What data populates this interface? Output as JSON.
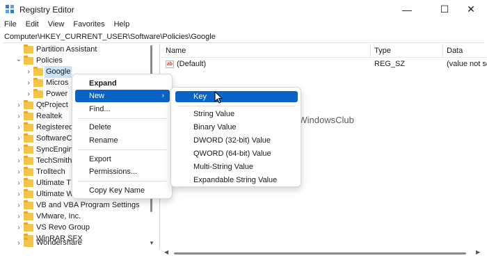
{
  "window": {
    "title": "Registry Editor",
    "controls": {
      "minimize": "—",
      "maximize": "☐",
      "close": "✕"
    }
  },
  "menubar": {
    "items": [
      "File",
      "Edit",
      "View",
      "Favorites",
      "Help"
    ]
  },
  "address": {
    "path": "Computer\\HKEY_CURRENT_USER\\Software\\Policies\\Google"
  },
  "tree": {
    "items": [
      {
        "label": "Partition Assistant",
        "expand": "",
        "depth": 1
      },
      {
        "label": "Policies",
        "expand": "⌄",
        "depth": 1
      },
      {
        "label": "Google",
        "expand": "›",
        "depth": 2,
        "selected": true
      },
      {
        "label": "Micros",
        "expand": "›",
        "depth": 2
      },
      {
        "label": "Power",
        "expand": "›",
        "depth": 2
      },
      {
        "label": "QtProject",
        "expand": "›",
        "depth": 1
      },
      {
        "label": "Realtek",
        "expand": "›",
        "depth": 1
      },
      {
        "label": "Registered",
        "expand": "›",
        "depth": 1
      },
      {
        "label": "SoftwareC",
        "expand": "›",
        "depth": 1
      },
      {
        "label": "SyncEngin",
        "expand": "›",
        "depth": 1
      },
      {
        "label": "TechSmith",
        "expand": "›",
        "depth": 1
      },
      {
        "label": "Trolltech",
        "expand": "›",
        "depth": 1
      },
      {
        "label": "Ultimate T",
        "expand": "›",
        "depth": 1
      },
      {
        "label": "Ultimate W",
        "expand": "›",
        "depth": 1
      },
      {
        "label": "VB and VBA Program Settings",
        "expand": "›",
        "depth": 1
      },
      {
        "label": "VMware, Inc.",
        "expand": "›",
        "depth": 1
      },
      {
        "label": "VS Revo Group",
        "expand": "›",
        "depth": 1
      },
      {
        "label": "WinRAR SFX",
        "expand": "",
        "depth": 1
      },
      {
        "label": "Wondershare",
        "expand": "›",
        "depth": 1
      }
    ]
  },
  "list": {
    "columns": {
      "name": "Name",
      "type": "Type",
      "data": "Data"
    },
    "rows": [
      {
        "icon": "ab",
        "name": "(Default)",
        "type": "REG_SZ",
        "data": "(value not se"
      }
    ]
  },
  "context_menu": {
    "items": [
      {
        "label": "Expand",
        "bold": true
      },
      {
        "label": "New",
        "highlighted": true,
        "submenu_arrow": "›"
      },
      {
        "label": "Find..."
      },
      {
        "label": "Delete"
      },
      {
        "label": "Rename"
      },
      {
        "label": "Export"
      },
      {
        "label": "Permissions..."
      },
      {
        "label": "Copy Key Name"
      }
    ]
  },
  "sub_menu": {
    "items": [
      {
        "label": "Key",
        "highlighted": true
      },
      {
        "label": "String Value"
      },
      {
        "label": "Binary Value"
      },
      {
        "label": "DWORD (32-bit) Value"
      },
      {
        "label": "QWORD (64-bit) Value"
      },
      {
        "label": "Multi-String Value"
      },
      {
        "label": "Expandable String Value"
      }
    ]
  },
  "watermark": {
    "text": "TheWindowsClub"
  },
  "colors": {
    "accent": "#0a64c8",
    "selection": "#cce4f7",
    "folder": "#f3c449",
    "watermark_logo": "#2f6fc4"
  }
}
